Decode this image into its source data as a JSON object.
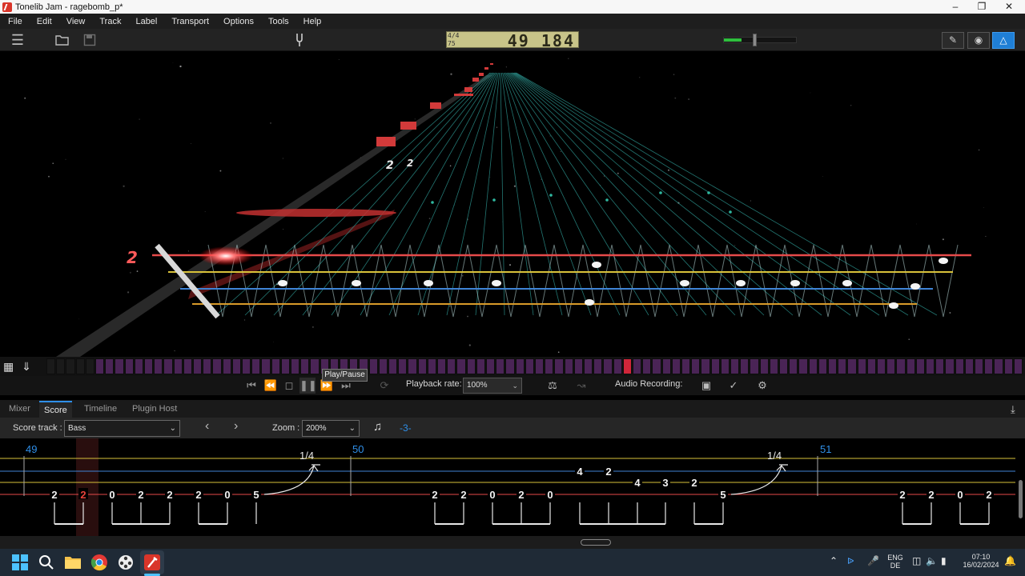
{
  "window": {
    "title": "Tonelib Jam - ragebomb_p*"
  },
  "menu": [
    "File",
    "Edit",
    "View",
    "Track",
    "Label",
    "Transport",
    "Options",
    "Tools",
    "Help"
  ],
  "position_display": {
    "time_signature": "4/4",
    "tempo": "75",
    "position": "49 184"
  },
  "volume_level": 0.4,
  "playhead_string_marker": "2",
  "tooltip": "Play/Pause",
  "transport": {
    "playback_rate_label": "Playback rate:",
    "playback_rate": "100%",
    "audio_recording_label": "Audio Recording:"
  },
  "tabs": [
    "Mixer",
    "Score",
    "Timeline",
    "Plugin Host"
  ],
  "score_controls": {
    "score_track_label": "Score track :",
    "score_track": "Bass",
    "zoom_label": "Zoom :",
    "zoom": "200%",
    "tuplet": "-3-"
  },
  "score": {
    "measures": [
      "49",
      "50",
      "51"
    ],
    "bends": [
      "1/4",
      "1/4"
    ],
    "tab_notes": [
      "2",
      "2",
      "0",
      "2",
      "2",
      "2",
      "0",
      "5",
      "2",
      "2",
      "0",
      "2",
      "0",
      "4",
      "2",
      "4",
      "3",
      "2",
      "5",
      "2",
      "2",
      "0",
      "2"
    ]
  },
  "taskbar": {
    "lang": "ENG",
    "region": "DE",
    "time": "07:10",
    "date": "16/02/2024"
  },
  "colors": {
    "accent": "#2f8fe8",
    "lcd": "#c8c489",
    "bar_active": "#d0263a",
    "strip": "#4a2456"
  }
}
